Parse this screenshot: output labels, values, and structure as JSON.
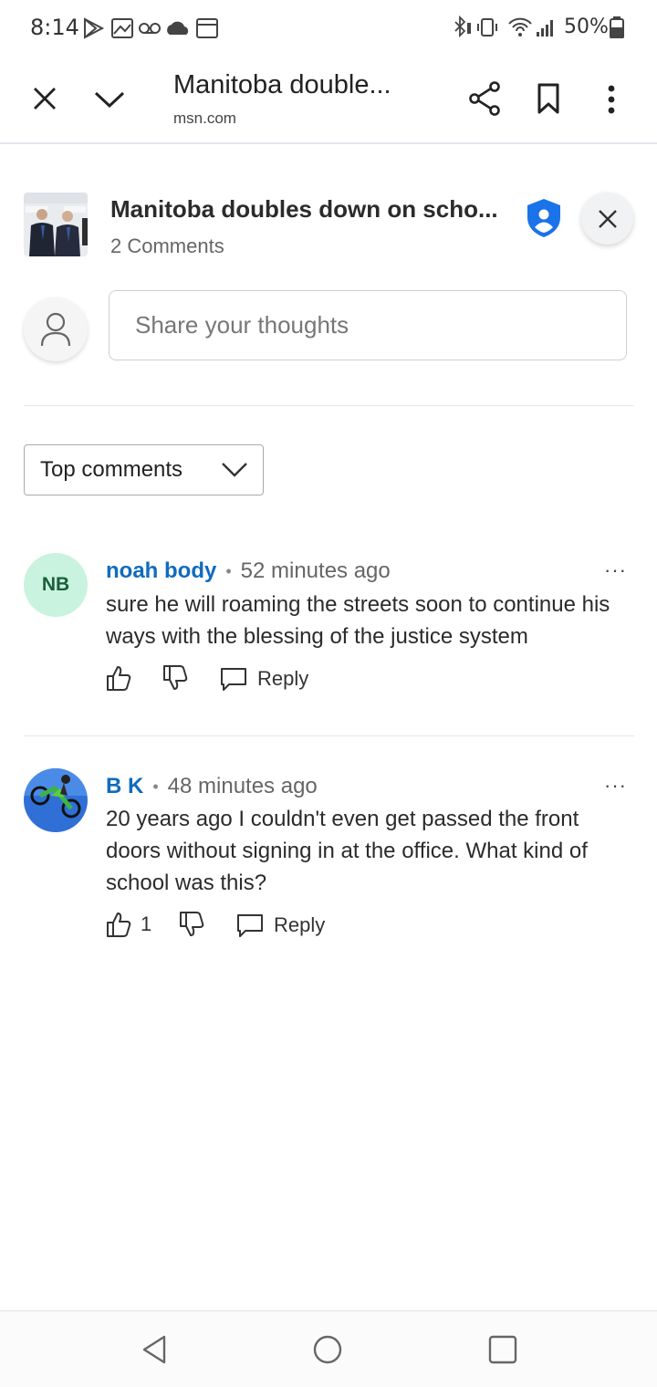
{
  "status_bar": {
    "time": "8:14",
    "battery": "50%"
  },
  "toolbar": {
    "title": "Manitoba double...",
    "url": "msn.com"
  },
  "article": {
    "title": "Manitoba doubles down on scho...",
    "comment_count": "2 Comments"
  },
  "composer": {
    "placeholder": "Share your thoughts"
  },
  "sort": {
    "selected": "Top comments"
  },
  "comments": [
    {
      "avatar_initials": "NB",
      "author": "noah body",
      "time": "52 minutes ago",
      "text": "sure he will roaming the streets soon to continue his ways with the blessing of the justice system",
      "likes": "",
      "reply_label": "Reply"
    },
    {
      "avatar_initials": "",
      "author": "B K",
      "time": "48 minutes ago",
      "text": "20 years ago I couldn't even get passed the front doors without signing in at the office. What kind of school was this?",
      "likes": "1",
      "reply_label": "Reply"
    }
  ],
  "colors": {
    "accent": "#0f6cbd",
    "shield": "#1a73e8",
    "nb_avatar_bg": "#c9f3df"
  }
}
